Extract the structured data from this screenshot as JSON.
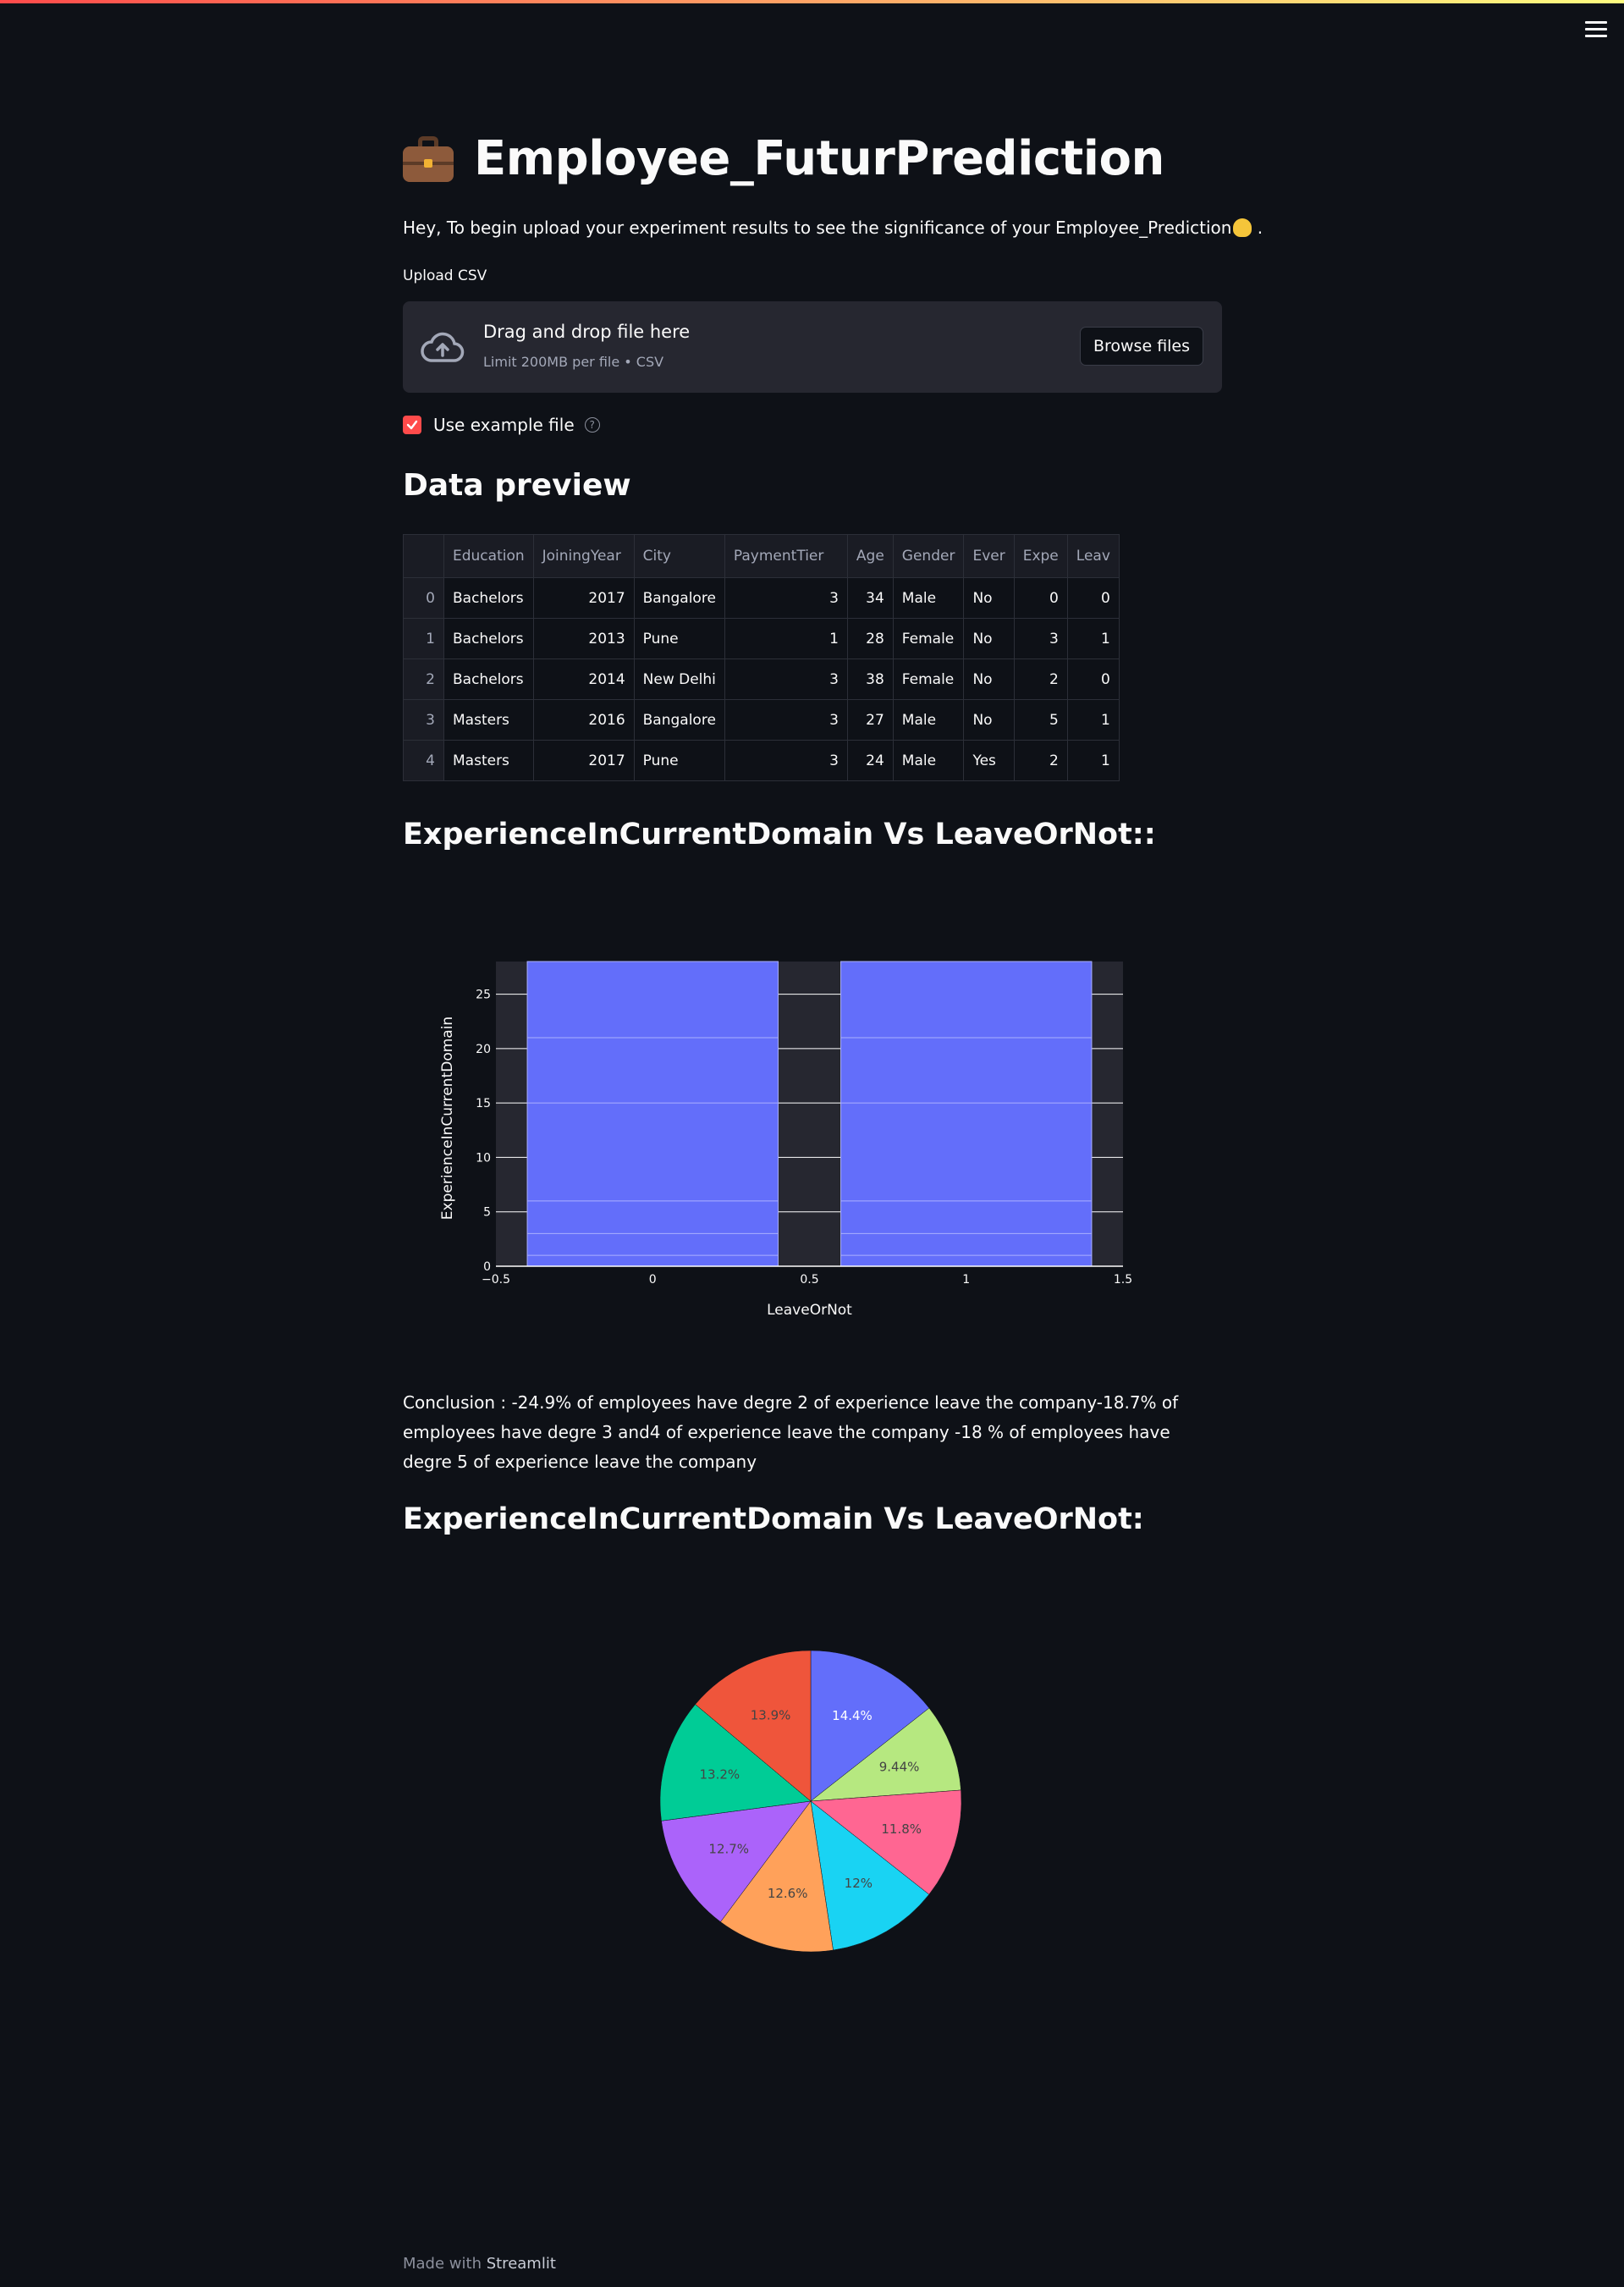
{
  "page": {
    "title": "Employee_FuturPrediction",
    "intro": "Hey, To begin upload your experiment results to see the significance of your Employee_Prediction",
    "intro_end": " ."
  },
  "upload": {
    "label": "Upload CSV",
    "drop_title": "Drag and drop file here",
    "drop_sub": "Limit 200MB per file • CSV",
    "browse": "Browse files"
  },
  "example": {
    "label": "Use example file",
    "checked": true,
    "help": "?"
  },
  "preview": {
    "heading": "Data preview",
    "columns": [
      "",
      "Education",
      "JoiningYear",
      "City",
      "PaymentTier",
      "Age",
      "Gender",
      "Ever",
      "Expe",
      "Leav"
    ],
    "rows": [
      [
        "0",
        "Bachelors",
        "2017",
        "Bangalore",
        "3",
        "34",
        "Male",
        "No",
        "0",
        "0"
      ],
      [
        "1",
        "Bachelors",
        "2013",
        "Pune",
        "1",
        "28",
        "Female",
        "No",
        "3",
        "1"
      ],
      [
        "2",
        "Bachelors",
        "2014",
        "New Delhi",
        "3",
        "38",
        "Female",
        "No",
        "2",
        "0"
      ],
      [
        "3",
        "Masters",
        "2016",
        "Bangalore",
        "3",
        "27",
        "Male",
        "No",
        "5",
        "1"
      ],
      [
        "4",
        "Masters",
        "2017",
        "Pune",
        "3",
        "24",
        "Male",
        "Yes",
        "2",
        "1"
      ]
    ]
  },
  "bar_section": {
    "heading": "ExperienceInCurrentDomain Vs LeaveOrNot::",
    "conclusion": "Conclusion : -24.9% of employees have degre 2 of experience leave the company-18.7% of employees have degre 3 and4 of experience leave the company -18 % of employees have degre 5 of experience leave the company"
  },
  "pie_section": {
    "heading": "ExperienceInCurrentDomain Vs LeaveOrNot:"
  },
  "chart_data": [
    {
      "type": "bar",
      "xlabel": "LeaveOrNot",
      "ylabel": "ExperienceInCurrentDomain",
      "xlim": [
        -0.5,
        1.5
      ],
      "ylim": [
        0,
        28
      ],
      "xticks": [
        "−0.5",
        "0",
        "0.5",
        "1",
        "1.5"
      ],
      "yticks": [
        "0",
        "5",
        "10",
        "15",
        "20",
        "25"
      ],
      "color": "#636efa",
      "bars": [
        {
          "x": 0,
          "value": 28,
          "segments": [
            0,
            1,
            3,
            6,
            15,
            21,
            28
          ]
        },
        {
          "x": 1,
          "value": 28,
          "segments": [
            0,
            1,
            3,
            6,
            15,
            21,
            28
          ]
        }
      ]
    },
    {
      "type": "pie",
      "slices": [
        {
          "label": "14.4%",
          "value": 14.4,
          "color": "#636efa",
          "text_color": "#ffffff"
        },
        {
          "label": "9.44%",
          "value": 9.44,
          "color": "#b6e880",
          "text_color": "#444444"
        },
        {
          "label": "11.8%",
          "value": 11.8,
          "color": "#ff6692",
          "text_color": "#444444"
        },
        {
          "label": "12%",
          "value": 12.0,
          "color": "#19d3f3",
          "text_color": "#444444"
        },
        {
          "label": "12.6%",
          "value": 12.6,
          "color": "#ffa15a",
          "text_color": "#444444"
        },
        {
          "label": "12.7%",
          "value": 12.7,
          "color": "#ab63fa",
          "text_color": "#444444"
        },
        {
          "label": "13.2%",
          "value": 13.2,
          "color": "#00cc96",
          "text_color": "#444444"
        },
        {
          "label": "13.9%",
          "value": 13.9,
          "color": "#ef553b",
          "text_color": "#444444"
        }
      ]
    }
  ],
  "footer": {
    "prefix": "Made with ",
    "brand": "Streamlit"
  }
}
